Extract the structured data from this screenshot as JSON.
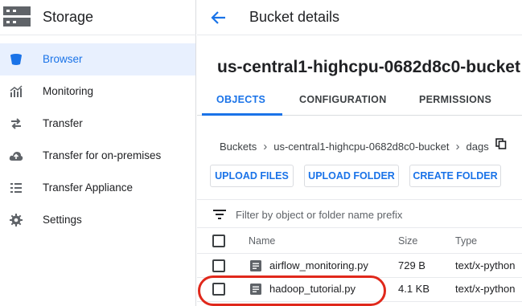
{
  "sidebar": {
    "title": "Storage",
    "items": [
      {
        "label": "Browser",
        "icon": "bucket-icon",
        "active": true
      },
      {
        "label": "Monitoring",
        "icon": "chart-icon"
      },
      {
        "label": "Transfer",
        "icon": "transfer-arrows-icon"
      },
      {
        "label": "Transfer for on-premises",
        "icon": "cloud-upload-icon"
      },
      {
        "label": "Transfer Appliance",
        "icon": "list-icon"
      },
      {
        "label": "Settings",
        "icon": "gear-icon"
      }
    ]
  },
  "header": {
    "title": "Bucket details"
  },
  "bucket": {
    "name": "us-central1-highcpu-0682d8c0-bucket"
  },
  "tabs": [
    {
      "label": "OBJECTS",
      "active": true
    },
    {
      "label": "CONFIGURATION"
    },
    {
      "label": "PERMISSIONS"
    }
  ],
  "breadcrumb": [
    "Buckets",
    "us-central1-highcpu-0682d8c0-bucket",
    "dags"
  ],
  "actions": {
    "upload_files": "UPLOAD FILES",
    "upload_folder": "UPLOAD FOLDER",
    "create_folder": "CREATE FOLDER"
  },
  "filter": {
    "placeholder": "Filter by object or folder name prefix",
    "value": ""
  },
  "table": {
    "columns": [
      "Name",
      "Size",
      "Type"
    ],
    "rows": [
      {
        "name": "airflow_monitoring.py",
        "size": "729 B",
        "type": "text/x-python"
      },
      {
        "name": "hadoop_tutorial.py",
        "size": "4.1 KB",
        "type": "text/x-python"
      }
    ]
  },
  "colors": {
    "accent": "#1a73e8",
    "highlight": "#e0281b",
    "active_bg": "#e8f0fe"
  }
}
